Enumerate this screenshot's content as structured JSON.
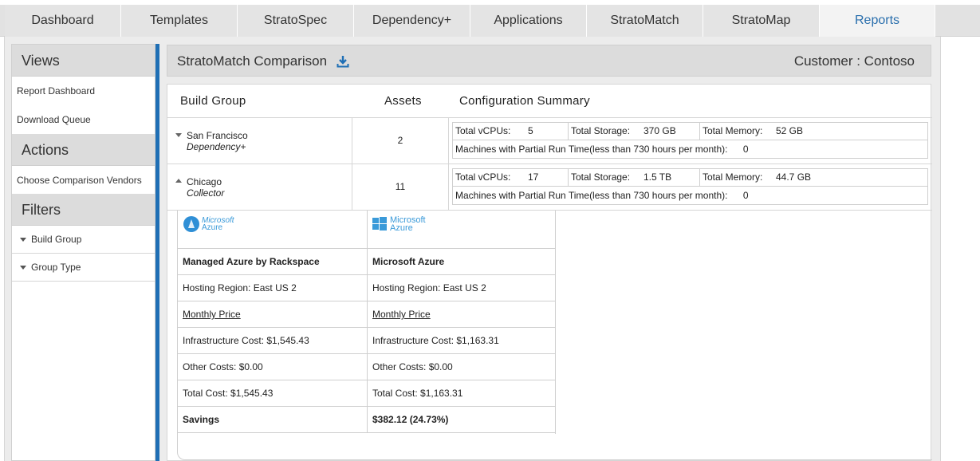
{
  "tabs": [
    {
      "label": "Dashboard"
    },
    {
      "label": "Templates"
    },
    {
      "label": "StratoSpec"
    },
    {
      "label": "Dependency+"
    },
    {
      "label": "Applications"
    },
    {
      "label": "StratoMatch"
    },
    {
      "label": "StratoMap"
    },
    {
      "label": "Reports"
    }
  ],
  "active_tab": "Reports",
  "sidebar": {
    "views_title": "Views",
    "views": [
      "Report Dashboard",
      "Download Queue"
    ],
    "actions_title": "Actions",
    "actions": [
      "Choose Comparison Vendors"
    ],
    "filters_title": "Filters",
    "filters": [
      "Build Group",
      "Group Type"
    ]
  },
  "header": {
    "title": "StratoMatch Comparison",
    "customer": "Customer : Contoso"
  },
  "table": {
    "col_build_group": "Build Group",
    "col_assets": "Assets",
    "col_config": "Configuration Summary",
    "groups": [
      {
        "name": "San Francisco",
        "type": "Dependency+",
        "assets": "2",
        "vcpus_label": "Total vCPUs:",
        "vcpus": "5",
        "storage_label": "Total Storage:",
        "storage": "370 GB",
        "memory_label": "Total Memory:",
        "memory": "52 GB",
        "partial_label": "Machines with Partial Run Time(less than 730 hours per month):",
        "partial": "0"
      },
      {
        "name": "Chicago",
        "type": "Collector",
        "assets": "11",
        "vcpus_label": "Total vCPUs:",
        "vcpus": "17",
        "storage_label": "Total Storage:",
        "storage": "1.5 TB",
        "memory_label": "Total Memory:",
        "memory": "44.7 GB",
        "partial_label": "Machines with Partial Run Time(less than 730 hours per month):",
        "partial": "0"
      }
    ]
  },
  "vendors": [
    {
      "logo_line1": "Microsoft",
      "logo_line2": "Azure",
      "name": "Managed Azure by Rackspace",
      "region": "Hosting Region: East US 2",
      "monthly_price": "Monthly Price",
      "infra": "Infrastructure Cost: $1,545.43",
      "other": "Other Costs: $0.00",
      "total": "Total Cost: $1,545.43",
      "savings": "Savings"
    },
    {
      "logo_line1": "Microsoft",
      "logo_line2": "Azure",
      "name": "Microsoft Azure",
      "region": "Hosting Region: East US 2",
      "monthly_price": "Monthly Price",
      "infra": "Infrastructure Cost: $1,163.31",
      "other": "Other Costs: $0.00",
      "total": "Total Cost: $1,163.31",
      "savings": "$382.12 (24.73%)"
    }
  ],
  "colors": {
    "accent": "#1f6fb5",
    "azure_blue": "#3a9ad9"
  },
  "icons": {
    "download": "download-icon",
    "azure_logo": "azure-logo-icon",
    "windows_logo": "windows-logo-icon"
  }
}
